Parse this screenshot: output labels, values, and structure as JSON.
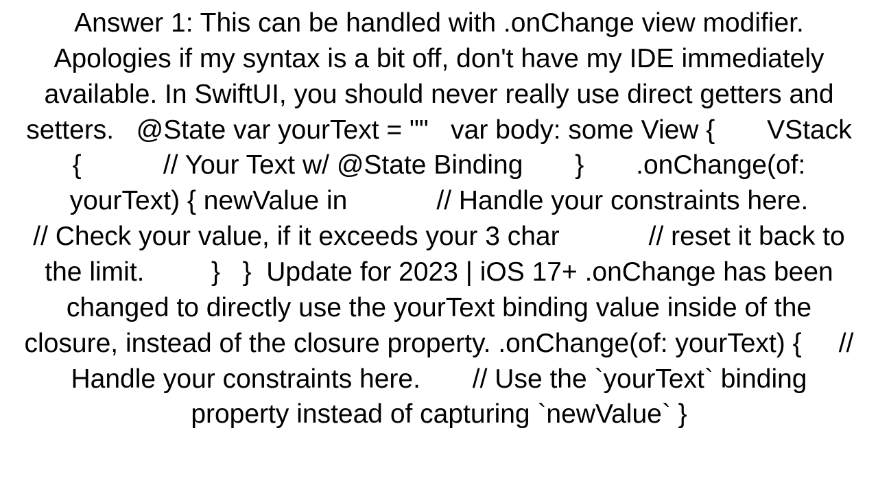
{
  "document": {
    "text": "Answer 1: This can be handled with .onChange view modifier. Apologies if my syntax is a bit off, don't have my IDE immediately available. In SwiftUI, you should never really use direct getters and setters.   @State var yourText = \"\"   var body: some View {       VStack {           // Your Text w/ @State Binding       }       .onChange(of: yourText) { newValue in            // Handle your constraints here.            // Check your value, if it exceeds your 3 char            // reset it back to the limit.         }   }  Update for 2023 | iOS 17+ .onChange has been changed to directly use the yourText binding value inside of the closure, instead of the closure property. .onChange(of: yourText) {     // Handle your constraints here.       // Use the `yourText` binding property instead of capturing `newValue` }"
  }
}
